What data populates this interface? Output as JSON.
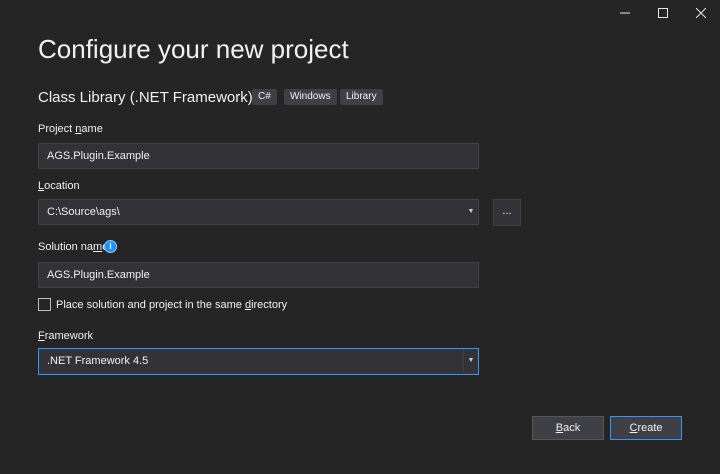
{
  "window": {
    "minimize_icon": "minimize-icon",
    "maximize_icon": "maximize-icon",
    "close_icon": "close-icon"
  },
  "heading": "Configure your new project",
  "template": {
    "name": "Class Library (.NET Framework)",
    "tags": [
      "C#",
      "Windows",
      "Library"
    ]
  },
  "project_name": {
    "label_pre": "Project ",
    "label_u": "n",
    "label_post": "ame",
    "value": "AGS.Plugin.Example"
  },
  "location": {
    "label_u": "L",
    "label_post": "ocation",
    "value": "C:\\Source\\ags\\",
    "browse_label": "..."
  },
  "solution_name": {
    "label_pre": "Solution na",
    "label_u": "m",
    "label_post": "e",
    "info_icon": "info-icon",
    "value": "AGS.Plugin.Example"
  },
  "same_directory": {
    "label_pre": "Place solution and project in the same ",
    "label_u": "d",
    "label_post": "irectory",
    "checked": false
  },
  "framework": {
    "label_u": "F",
    "label_post": "ramework",
    "value": ".NET Framework 4.5"
  },
  "buttons": {
    "back_u": "B",
    "back_post": "ack",
    "create_u": "C",
    "create_post": "reate"
  },
  "colors": {
    "background": "#252526",
    "field": "#333337",
    "accent": "#3399ff",
    "info": "#1e90ff"
  }
}
